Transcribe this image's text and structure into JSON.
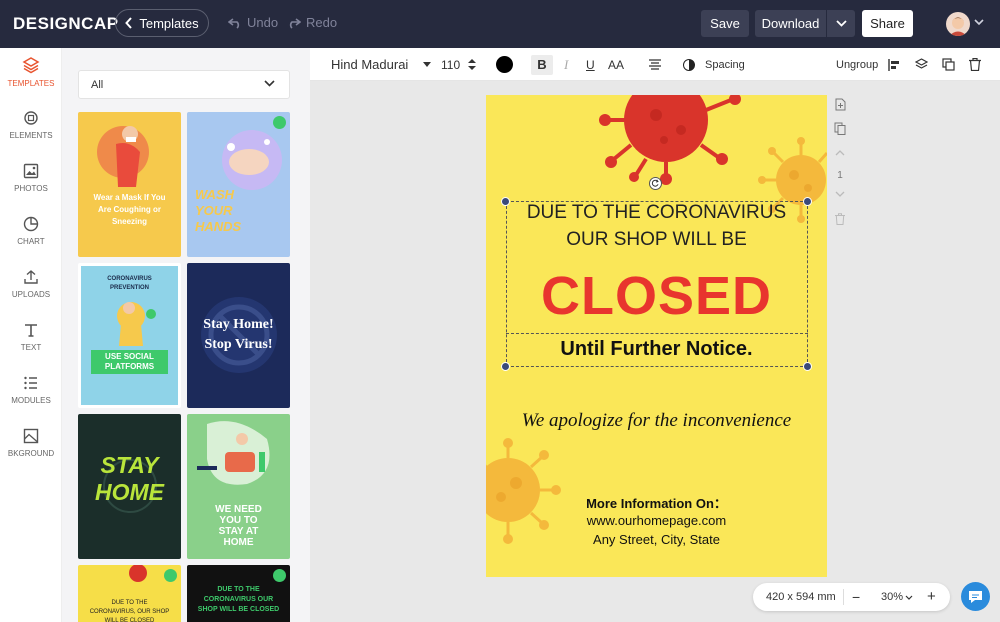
{
  "topbar": {
    "logo": "DESIGNCAP",
    "templates_label": "Templates",
    "undo_label": "Undo",
    "redo_label": "Redo",
    "save_label": "Save",
    "download_label": "Download",
    "share_label": "Share"
  },
  "sidebar": {
    "items": [
      {
        "label": "TEMPLATES",
        "icon": "layers-icon"
      },
      {
        "label": "ELEMENTS",
        "icon": "shapes-icon"
      },
      {
        "label": "PHOTOS",
        "icon": "image-icon"
      },
      {
        "label": "CHART",
        "icon": "pie-chart-icon"
      },
      {
        "label": "UPLOADS",
        "icon": "upload-icon"
      },
      {
        "label": "TEXT",
        "icon": "text-icon"
      },
      {
        "label": "MODULES",
        "icon": "list-icon"
      },
      {
        "label": "BKGROUND",
        "icon": "background-icon"
      }
    ]
  },
  "panel": {
    "filter_value": "All",
    "templates": [
      {
        "title": "Wear a Mask If You Are Coughing or Sneezing",
        "bg": "#f6c94c"
      },
      {
        "title": "WASH YOUR HANDS",
        "bg": "#a8c8f0"
      },
      {
        "title": "CORONAVIRUS PREVENTION",
        "subtitle": "USE SOCIAL PLATFORMS",
        "bg": "#8fd3e8"
      },
      {
        "title": "Stay Home! Stop Virus!",
        "bg": "#1c2a5a"
      },
      {
        "title": "STAY HOME",
        "bg": "#1b2e2a"
      },
      {
        "title": "WE NEED YOU TO STAY AT HOME",
        "bg": "#8ad08a"
      },
      {
        "title": "DUE TO THE CORONAVIRUS, OUR SHOP WILL BE CLOSED",
        "bg": "#f6de48"
      },
      {
        "title": "DUE TO THE CORONAVIRUS OUR SHOP WILL BE CLOSED",
        "bg": "#111111"
      }
    ]
  },
  "toolbar": {
    "font_name": "Hind Madurai",
    "font_size": "110",
    "text_color": "#000000",
    "bold_label": "B",
    "italic_label": "I",
    "underline_label": "U",
    "case_label": "AA",
    "spacing_label": "Spacing",
    "ungroup_label": "Ungroup"
  },
  "poster": {
    "line1": "DUE TO THE CORONAVIRUS",
    "line2": "OUR SHOP WILL BE",
    "headline": "CLOSED",
    "subheadline": "Until Further Notice.",
    "apology": "We apologize for the inconvenience",
    "more_info": "More Information On：",
    "website": "www.ourhomepage.com",
    "address": "Any Street, City, State",
    "bg_color": "#fae758",
    "accent_color": "#e8352e"
  },
  "page_nav": {
    "page_number": "1"
  },
  "zoom": {
    "dimensions": "420 x 594 mm",
    "minus_label": "−",
    "level": "30%",
    "plus_label": "+"
  }
}
